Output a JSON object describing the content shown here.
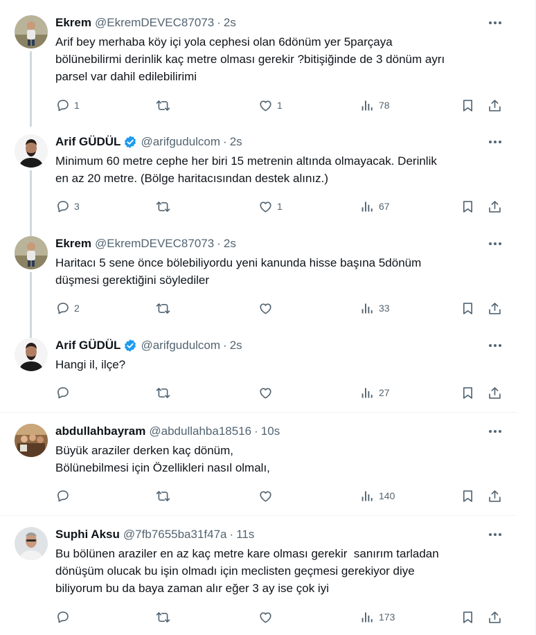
{
  "colors": {
    "text": "#0f1419",
    "muted": "#536471",
    "thread_line": "#cfd9de",
    "verified": "#1d9bf0",
    "divider": "#eff3f4"
  },
  "tweets": [
    {
      "name": "Ekrem",
      "handle": "@EkremDEVEC87073",
      "separator": "·",
      "time": "2s",
      "verified": false,
      "avatar": "avatar-child-outdoor",
      "lines": [
        "Arif bey merhaba köy içi yola cephesi olan 6dönüm yer 5parçaya",
        "bölünebilirmi derinlik kaç metre olması gerekir ?bitişiğinde de 3 dönüm ayrı",
        "parsel var dahil edilebilirimi"
      ],
      "replies": "1",
      "retweets": "",
      "likes": "1",
      "views": "78"
    },
    {
      "name": "Arif GÜDÜL",
      "handle": "@arifgudulcom",
      "separator": "·",
      "time": "2s",
      "verified": true,
      "avatar": "avatar-man-dark",
      "lines": [
        "Minimum 60 metre cephe her biri 15 metrenin altında olmayacak. Derinlik",
        "en az 20 metre. (Bölge haritacısından destek alınız.)"
      ],
      "replies": "3",
      "retweets": "",
      "likes": "1",
      "views": "67"
    },
    {
      "name": "Ekrem",
      "handle": "@EkremDEVEC87073",
      "separator": "·",
      "time": "2s",
      "verified": false,
      "avatar": "avatar-child-outdoor",
      "lines": [
        "Haritacı 5 sene önce bölebiliyordu yeni kanunda hisse başına 5dönüm",
        "düşmesi gerektiğini söylediler"
      ],
      "replies": "2",
      "retweets": "",
      "likes": "",
      "views": "33"
    },
    {
      "name": "Arif GÜDÜL",
      "handle": "@arifgudulcom",
      "separator": "·",
      "time": "2s",
      "verified": true,
      "avatar": "avatar-man-dark",
      "lines": [
        "Hangi il, ilçe?"
      ],
      "replies": "",
      "retweets": "",
      "likes": "",
      "views": "27"
    },
    {
      "name": "abdullahbayram",
      "handle": "@abdullahba18516",
      "separator": "·",
      "time": "10s",
      "verified": false,
      "avatar": "avatar-group-photo",
      "lines": [
        "Büyük araziler derken kaç dönüm,",
        "Bölünebilmesi için Özellikleri nasıl olmalı,"
      ],
      "replies": "",
      "retweets": "",
      "likes": "",
      "views": "140"
    },
    {
      "name": "Suphi Aksu",
      "handle": "@7fb7655ba31f47a",
      "separator": "·",
      "time": "11s",
      "verified": false,
      "avatar": "avatar-man-light",
      "lines": [
        "Bu bölünen araziler en az kaç metre kare olması gerekir  sanırım tarladan",
        "dönüşüm olucak bu işin olmadı için meclisten geçmesi gerekiyor diye",
        "biliyorum bu da baya zaman alır eğer 3 ay ise çok iyi"
      ],
      "replies": "",
      "retweets": "",
      "likes": "",
      "views": "173"
    }
  ]
}
